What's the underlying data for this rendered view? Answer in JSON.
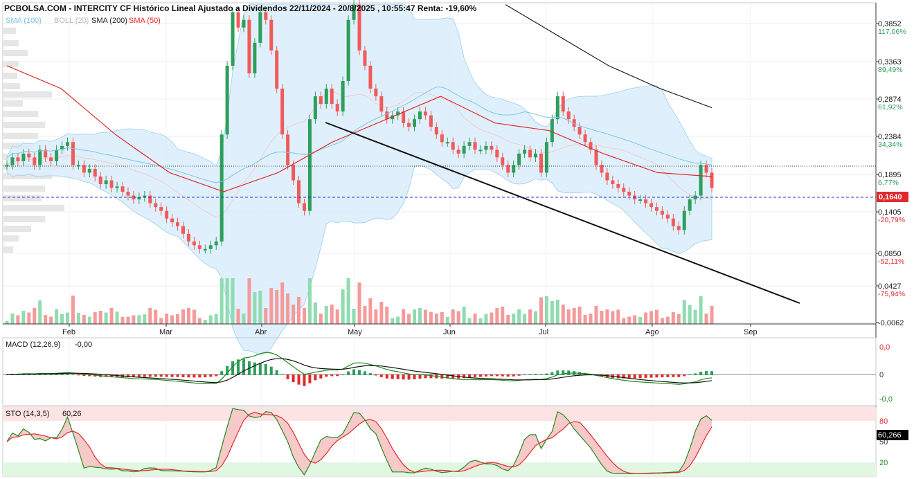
{
  "header": {
    "title": "PCBOLSA.COM - INTERCITY CF Histórico Lineal Ajustado a Dividendos 22/11/2024 - 20/8/2025 , 10:55:47 Renta: -19,60%"
  },
  "legend": {
    "sma100": "SMA (100)",
    "boll": "BOLL (20)",
    "sma200": "SMA (200)",
    "sma50": "SMA (50)"
  },
  "colors": {
    "up": "#2e9e5b",
    "down": "#f05a5a",
    "sma50": "#e0292b",
    "sma100": "#7cc4ea",
    "sma200": "#222222",
    "boll_fill": "#d8ecfb",
    "last_price_bg": "#e0292b"
  },
  "price_axis": {
    "ticks": [
      {
        "price": "0,3852",
        "pct": "117,06%",
        "pos": true
      },
      {
        "price": "0,3363",
        "pct": "89,49%",
        "pos": true
      },
      {
        "price": "0,2874",
        "pct": "61,92%",
        "pos": true
      },
      {
        "price": "0,2384",
        "pct": "34,34%",
        "pos": true
      },
      {
        "price": "0,1895",
        "pct": "6,77%",
        "pos": true
      },
      {
        "price": "0,1405",
        "pct": "-20,79%",
        "pos": false
      },
      {
        "price": "0,0850",
        "pct": "-52,11%",
        "pos": false
      },
      {
        "price": "0,0427",
        "pct": "-75,94%",
        "pos": false
      },
      {
        "price": "-0,0062",
        "pct": "",
        "pos": false
      }
    ],
    "last_price": "0,1640"
  },
  "time_axis": {
    "labels": [
      "Feb",
      "Mar",
      "Abr",
      "May",
      "Jun",
      "Jul",
      "Ago",
      "Sep"
    ]
  },
  "macd": {
    "title": "MACD (12,26,9)",
    "value": "-0,00",
    "ticks": [
      "0,0",
      "0",
      "-0,0"
    ]
  },
  "sto": {
    "title": "STO (14,3,5)",
    "value": "60,26",
    "ticks": [
      "80",
      "50",
      "20"
    ],
    "last": "60,266"
  },
  "chart_data": {
    "type": "candlestick",
    "y_range": [
      -0.0062,
      0.41
    ],
    "trendline": {
      "from": {
        "date": "2025-04-16",
        "price": 0.256
      },
      "to": {
        "date": "2025-09-27",
        "price": 0.06
      }
    },
    "reference_levels": [
      0.2,
      0.164
    ],
    "series_close_path": [
      [
        0.2,
        0.21,
        0.205,
        0.215,
        0.21,
        0.2,
        0.22,
        0.21,
        0.205,
        0.22,
        0.225,
        0.23,
        0.2,
        0.2,
        0.19,
        0.195,
        0.185,
        0.175,
        0.18,
        0.17,
        0.172,
        0.165,
        0.16,
        0.155,
        0.158,
        0.16,
        0.15,
        0.145,
        0.14,
        0.13,
        0.125,
        0.12,
        0.11,
        0.1,
        0.095,
        0.09,
        0.09,
        0.095,
        0.1,
        0.24,
        0.33,
        0.4,
        0.38,
        0.39,
        0.32,
        0.36,
        0.4,
        0.39,
        0.35,
        0.3,
        0.24,
        0.2,
        0.18,
        0.15,
        0.14,
        0.26,
        0.29,
        0.28,
        0.3,
        0.28,
        0.27,
        0.31,
        0.39,
        0.41,
        0.35,
        0.33,
        0.3,
        0.29,
        0.27,
        0.26,
        0.265,
        0.27,
        0.255,
        0.25,
        0.26,
        0.27,
        0.265,
        0.25,
        0.24,
        0.23,
        0.23,
        0.22,
        0.215,
        0.225,
        0.23,
        0.22,
        0.22,
        0.225,
        0.22,
        0.21,
        0.2,
        0.19,
        0.2,
        0.215,
        0.22,
        0.21,
        0.215,
        0.19,
        0.23,
        0.26,
        0.29,
        0.27,
        0.26,
        0.25,
        0.24,
        0.23,
        0.22,
        0.2,
        0.19,
        0.18,
        0.175,
        0.17,
        0.165,
        0.16,
        0.155,
        0.155,
        0.15,
        0.145,
        0.14,
        0.135,
        0.13,
        0.12,
        0.115,
        0.14,
        0.155,
        0.16,
        0.2,
        0.19,
        0.17
      ]
    ],
    "sma50_ref": [
      0.33,
      0.3,
      0.24,
      0.19,
      0.165,
      0.19,
      0.23,
      0.26,
      0.29,
      0.255,
      0.245,
      0.215,
      0.19,
      0.185
    ],
    "sma200_ref": [
      0.41,
      0.37,
      0.33,
      0.3,
      0.275
    ],
    "macd_hist_sign": "mixed",
    "sto_last": 60.266
  }
}
